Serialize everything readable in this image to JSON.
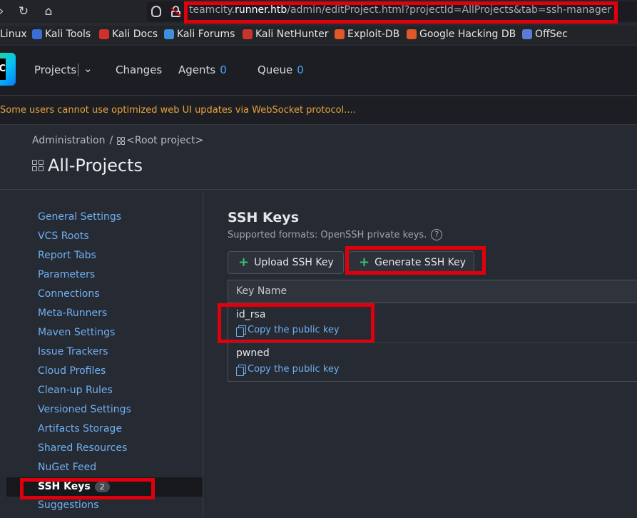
{
  "browser": {
    "url_prefix": "teamcity.",
    "url_host": "runner.htb",
    "url_path": "/admin/editProject.html?projectId=AllProjects&tab=ssh-manager",
    "bookmarks": [
      {
        "label": "Linux",
        "icon": "none",
        "color": ""
      },
      {
        "label": "Kali Tools",
        "icon": "kali-tools-icon",
        "color": "#3a6fd8"
      },
      {
        "label": "Kali Docs",
        "icon": "kali-docs-icon",
        "color": "#d0312d"
      },
      {
        "label": "Kali Forums",
        "icon": "kali-forums-icon",
        "color": "#3f8fe0"
      },
      {
        "label": "Kali NetHunter",
        "icon": "nethunter-icon",
        "color": "#c8352f"
      },
      {
        "label": "Exploit-DB",
        "icon": "exploit-db-icon",
        "color": "#e0572a"
      },
      {
        "label": "Google Hacking DB",
        "icon": "ghdb-icon",
        "color": "#e0572a"
      },
      {
        "label": "OffSec",
        "icon": "offsec-icon",
        "color": "#5a7bd8"
      }
    ]
  },
  "header": {
    "logo_letter": "C",
    "nav": [
      {
        "label": "Projects",
        "count": ""
      },
      {
        "label": "Changes",
        "count": ""
      },
      {
        "label": "Agents",
        "count": "0"
      },
      {
        "label": "Queue",
        "count": "0"
      }
    ]
  },
  "warning": "Some users cannot use optimized web UI updates via WebSocket protocol....",
  "breadcrumb": {
    "root": "Administration",
    "sep": "/",
    "project": "<Root project>"
  },
  "page_title": "All-Projects",
  "sidebar": {
    "items": [
      "General Settings",
      "VCS Roots",
      "Report Tabs",
      "Parameters",
      "Connections",
      "Meta-Runners",
      "Maven Settings",
      "Issue Trackers",
      "Cloud Profiles",
      "Clean-up Rules",
      "Versioned Settings",
      "Artifacts Storage",
      "Shared Resources",
      "NuGet Feed"
    ],
    "active": {
      "label": "SSH Keys",
      "count": "2"
    },
    "after": [
      "Suggestions"
    ]
  },
  "ssh": {
    "title": "SSH Keys",
    "subtitle": "Supported formats: OpenSSH private keys.",
    "help": "?",
    "upload_label": "Upload SSH Key",
    "generate_label": "Generate SSH Key",
    "column_header": "Key Name",
    "copy_label": "Copy the public key",
    "keys": [
      "id_rsa",
      "pwned"
    ]
  },
  "colors": {
    "accent_link": "#6fb0f2",
    "highlight": "#e0000b",
    "warning": "#e8a33d"
  }
}
